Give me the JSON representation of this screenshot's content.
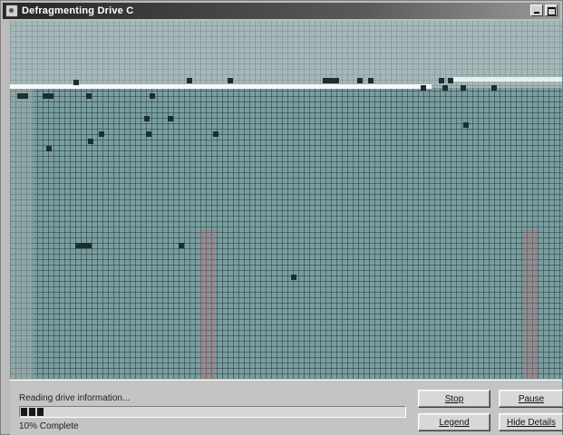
{
  "window": {
    "title": "Defragmenting Drive C",
    "icon": "defrag-app-icon",
    "controls": [
      "minimize-icon",
      "maximize-icon"
    ]
  },
  "colors": {
    "map_background": "#7a9ea0",
    "fragment": "#1d2e30",
    "panel": "#c4c4c4",
    "titlebar_start": "#262626"
  },
  "status": {
    "message": "Reading drive information...",
    "progress_percent": 10,
    "percent_label": "10% Complete"
  },
  "buttons": {
    "stop": "Stop",
    "pause": "Pause",
    "legend": "Legend",
    "hide_details": "Hide Details"
  }
}
